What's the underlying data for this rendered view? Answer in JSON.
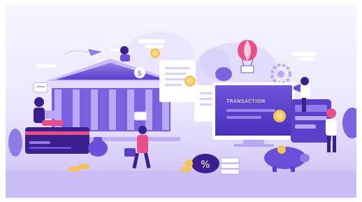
{
  "illustration": {
    "screen_text": "TRANSACTION",
    "coin_symbol": "$",
    "percent_symbol": "%",
    "colors": {
      "background_top": "#f6f3ff",
      "background_bottom": "#cdbff7",
      "violet_dark": "#3b1f8c",
      "violet_mid": "#6a4fd8",
      "violet_light": "#b8a8f5",
      "pink": "#e84e8a",
      "coin_gold": "#f6c35a",
      "white": "#ffffff"
    }
  }
}
